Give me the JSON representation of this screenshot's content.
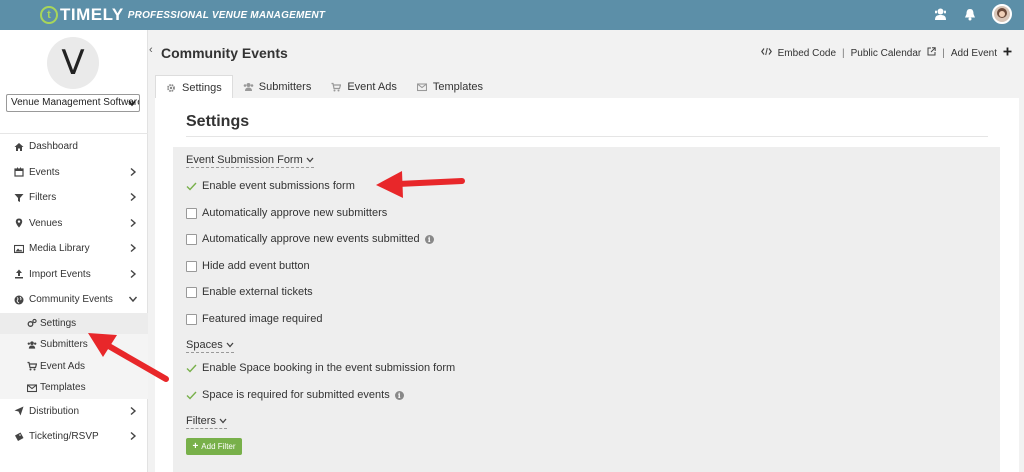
{
  "header": {
    "brand": "TIMELY",
    "brand_mark": "t",
    "tagline": "PROFESSIONAL VENUE MANAGEMENT",
    "icons": [
      "user-support-icon",
      "bell-icon",
      "user-avatar"
    ]
  },
  "sidebar": {
    "venue_initial": "V",
    "venue_select": "Venue Management Software",
    "collapse": "‹",
    "items": [
      {
        "label": "Dashboard",
        "icon": "home-icon",
        "arrow": ""
      },
      {
        "label": "Events",
        "icon": "calendar-icon",
        "arrow": "right"
      },
      {
        "label": "Filters",
        "icon": "filter-icon",
        "arrow": "right"
      },
      {
        "label": "Venues",
        "icon": "map-pin-icon",
        "arrow": "right"
      },
      {
        "label": "Media Library",
        "icon": "image-icon",
        "arrow": "right"
      },
      {
        "label": "Import Events",
        "icon": "upload-icon",
        "arrow": "right"
      },
      {
        "label": "Community Events",
        "icon": "globe-icon",
        "arrow": "down"
      }
    ],
    "sub_items": [
      {
        "label": "Settings",
        "icon": "cogs-icon"
      },
      {
        "label": "Submitters",
        "icon": "users-icon"
      },
      {
        "label": "Event Ads",
        "icon": "cart-icon"
      },
      {
        "label": "Templates",
        "icon": "envelope-icon"
      }
    ],
    "bottom_items": [
      {
        "label": "Distribution",
        "icon": "send-icon",
        "arrow": "right"
      },
      {
        "label": "Ticketing/RSVP",
        "icon": "ticket-icon",
        "arrow": "right"
      }
    ]
  },
  "page": {
    "title": "Community Events",
    "actions": {
      "embed": "Embed Code",
      "public_calendar": "Public Calendar",
      "add_event": "Add Event",
      "sep": "|"
    },
    "tabs": [
      {
        "label": "Settings",
        "icon": "gear-icon"
      },
      {
        "label": "Submitters",
        "icon": "users-icon"
      },
      {
        "label": "Event Ads",
        "icon": "cart-icon"
      },
      {
        "label": "Templates",
        "icon": "envelope-icon"
      }
    ]
  },
  "settings": {
    "heading": "Settings",
    "submission_section": "Event Submission Form",
    "submission_options": [
      {
        "label": "Enable event submissions form",
        "checked": true,
        "info": false
      },
      {
        "label": "Automatically approve new submitters",
        "checked": false,
        "info": false
      },
      {
        "label": "Automatically approve new events submitted",
        "checked": false,
        "info": true
      },
      {
        "label": "Hide add event button",
        "checked": false,
        "info": false
      },
      {
        "label": "Enable external tickets",
        "checked": false,
        "info": false
      },
      {
        "label": "Featured image required",
        "checked": false,
        "info": false
      }
    ],
    "spaces_section": "Spaces",
    "spaces_options": [
      {
        "label": "Enable Space booking in the event submission form",
        "checked": true,
        "info": false
      },
      {
        "label": "Space is required for submitted events",
        "checked": true,
        "info": true
      }
    ],
    "filters_section": "Filters",
    "add_filter": "Add Filter",
    "info_glyph": "i",
    "chevron": "⌄"
  },
  "colors": {
    "topbar": "#5c8fa8",
    "accent_green": "#78b04a",
    "annotation_arrow": "#e8272a"
  }
}
